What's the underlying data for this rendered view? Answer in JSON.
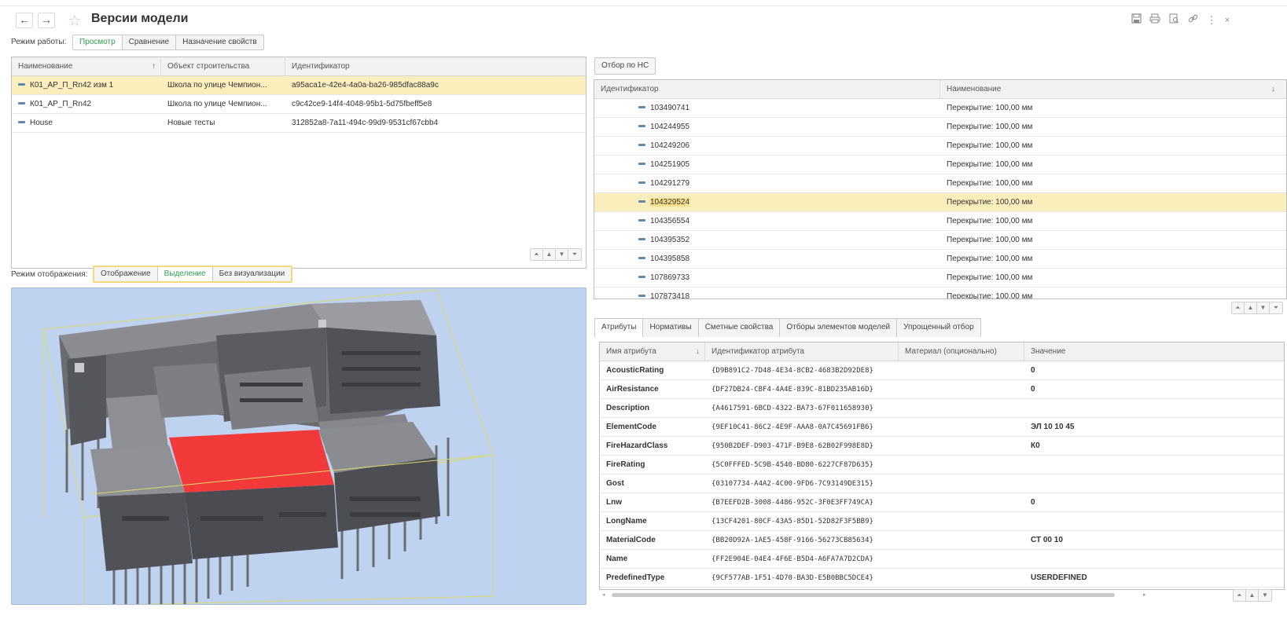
{
  "header": {
    "title": "Версии модели",
    "back": "←",
    "forward": "→",
    "icons": [
      "save-icon",
      "print-icon",
      "preview-icon",
      "link-icon",
      "more-icon",
      "close-icon"
    ]
  },
  "work_mode": {
    "label": "Режим работы:",
    "options": [
      "Просмотр",
      "Сравнение",
      "Назначение свойств"
    ],
    "active": "Просмотр"
  },
  "versions_table": {
    "columns": [
      "Наименование",
      "Объект строительства",
      "Идентификатор"
    ],
    "sort_arrow": "↑",
    "rows": [
      {
        "name": "К01_АР_П_Rn42 изм 1",
        "object": "Школа по улице Чемпион...",
        "id": "a95aca1e-42e4-4a0a-ba26-985dfac88a9c"
      },
      {
        "name": "К01_АР_П_Rn42",
        "object": "Школа по улице Чемпион...",
        "id": "c9c42ce9-14f4-4048-95b1-5d75fbeff5e8"
      },
      {
        "name": "House",
        "object": "Новые тесты",
        "id": "312852a8-7a11-494c-99d9-9531cf67cbb4"
      }
    ],
    "selected_index": 0
  },
  "display_mode": {
    "label": "Режим отображения:",
    "options": [
      "Отображение",
      "Выделение",
      "Без визуализации"
    ],
    "active": "Выделение"
  },
  "filter_button": "Отбор по НС",
  "elements_table": {
    "columns": [
      "Идентификатор",
      "Наименование"
    ],
    "sort_arrow": "↓",
    "rows": [
      {
        "id": "103490741",
        "name": "Перекрытие: 100,00 мм"
      },
      {
        "id": "104244955",
        "name": "Перекрытие: 100,00 мм"
      },
      {
        "id": "104249206",
        "name": "Перекрытие: 100,00 мм"
      },
      {
        "id": "104251905",
        "name": "Перекрытие: 100,00 мм"
      },
      {
        "id": "104291279",
        "name": "Перекрытие: 100,00 мм"
      },
      {
        "id": "104329524",
        "name": "Перекрытие: 100,00 мм"
      },
      {
        "id": "104356554",
        "name": "Перекрытие: 100,00 мм"
      },
      {
        "id": "104395352",
        "name": "Перекрытие: 100,00 мм"
      },
      {
        "id": "104395858",
        "name": "Перекрытие: 100,00 мм"
      },
      {
        "id": "107869733",
        "name": "Перекрытие: 100,00 мм"
      },
      {
        "id": "107873418",
        "name": "Перекрытие: 100,00 мм"
      }
    ],
    "selected_index": 5
  },
  "tabs": {
    "items": [
      "Атрибуты",
      "Нормативы",
      "Сметные свойства",
      "Отборы элементов моделей",
      "Упрощенный отбор"
    ],
    "active": "Атрибуты"
  },
  "attributes_table": {
    "columns": [
      "Имя атрибута",
      "Идентификатор атрибута",
      "Материал (опционально)",
      "Значение"
    ],
    "sort_arrow": "↓",
    "rows": [
      {
        "name": "AcousticRating",
        "guid": "{D9B891C2-7D48-4E34-8CB2-4683B2D92DE8}",
        "material": "",
        "value": "0"
      },
      {
        "name": "AirResistance",
        "guid": "{DF27DB24-CBF4-4A4E-839C-81BD235AB16D}",
        "material": "",
        "value": "0"
      },
      {
        "name": "Description",
        "guid": "{A4617591-6BCD-4322-BA73-67F011658930}",
        "material": "",
        "value": ""
      },
      {
        "name": "ElementCode",
        "guid": "{9EF10C41-86C2-4E9F-AAA8-0A7C45691FB6}",
        "material": "",
        "value": "ЭЛ 10 10 45"
      },
      {
        "name": "FireHazardClass",
        "guid": "{950B2DEF-D903-471F-B9E8-62B02F998E8D}",
        "material": "",
        "value": "К0"
      },
      {
        "name": "FireRating",
        "guid": "{5C0FFFED-5C9B-4540-BD80-6227CF87D635}",
        "material": "",
        "value": ""
      },
      {
        "name": "Gost",
        "guid": "{03107734-A4A2-4C00-9FD6-7C93149DE315}",
        "material": "",
        "value": ""
      },
      {
        "name": "Lnw",
        "guid": "{B7EEFD2B-3008-4486-952C-3F0E3FF749CA}",
        "material": "",
        "value": "0"
      },
      {
        "name": "LongName",
        "guid": "{13CF4201-80CF-43A5-85D1-52D82F3F5BB9}",
        "material": "",
        "value": ""
      },
      {
        "name": "MaterialCode",
        "guid": "{BB20D92A-1AE5-458F-9166-56273CB85634}",
        "material": "",
        "value": "СТ 00 10"
      },
      {
        "name": "Name",
        "guid": "{FF2E904E-04E4-4F6E-B5D4-A6FA7A7D2CDA}",
        "material": "",
        "value": ""
      },
      {
        "name": "PredefinedType",
        "guid": "{9CF577AB-1F51-4D70-BA3D-E5B0BBC5DCE4}",
        "material": "",
        "value": "USERDEFINED"
      }
    ]
  },
  "colors": {
    "accent_green": "#2e9e4c",
    "selection": "#fbeebd",
    "highlight_red": "#f23a3a",
    "viewer_bg": "#bfd2ef"
  }
}
